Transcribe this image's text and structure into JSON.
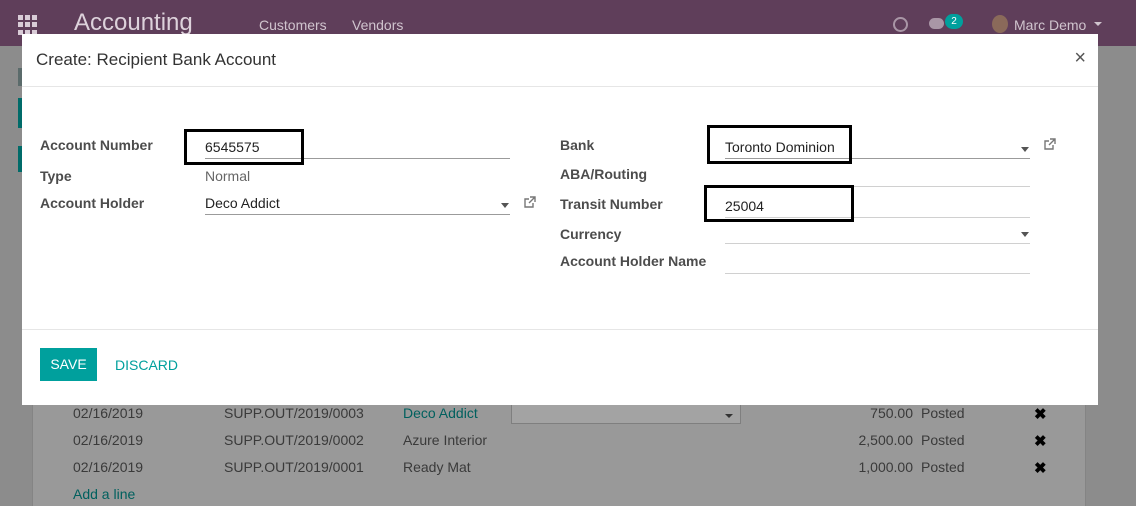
{
  "app": {
    "title": "Accounting",
    "menu": [
      "Customers",
      "Vendors"
    ],
    "chat_badge": "2",
    "user": "Marc Demo"
  },
  "background_list": {
    "rows": [
      {
        "date": "02/16/2019",
        "reference": "SUPP.OUT/2019/0003",
        "partner": "Deco Addict",
        "amount": "750.00",
        "status": "Posted"
      },
      {
        "date": "02/16/2019",
        "reference": "SUPP.OUT/2019/0002",
        "partner": "Azure Interior",
        "amount": "2,500.00",
        "status": "Posted"
      },
      {
        "date": "02/16/2019",
        "reference": "SUPP.OUT/2019/0001",
        "partner": "Ready Mat",
        "amount": "1,000.00",
        "status": "Posted"
      }
    ],
    "add_line": "Add a line",
    "delete_glyph": "✖"
  },
  "modal": {
    "title": "Create: Recipient Bank Account",
    "close_glyph": "×",
    "left": {
      "account_number": {
        "label": "Account Number",
        "value": "6545575"
      },
      "type": {
        "label": "Type",
        "value": "Normal"
      },
      "account_holder": {
        "label": "Account Holder",
        "value": "Deco Addict"
      }
    },
    "right": {
      "bank": {
        "label": "Bank",
        "value": "Toronto Dominion"
      },
      "aba_routing": {
        "label": "ABA/Routing",
        "value": ""
      },
      "transit_number": {
        "label": "Transit Number",
        "value": "25004"
      },
      "currency": {
        "label": "Currency",
        "value": ""
      },
      "account_holder_name": {
        "label": "Account Holder Name",
        "value": ""
      }
    },
    "footer": {
      "save": "SAVE",
      "discard": "DISCARD"
    }
  },
  "colors": {
    "brand": "#5f3e5a",
    "accent": "#00a09d"
  }
}
